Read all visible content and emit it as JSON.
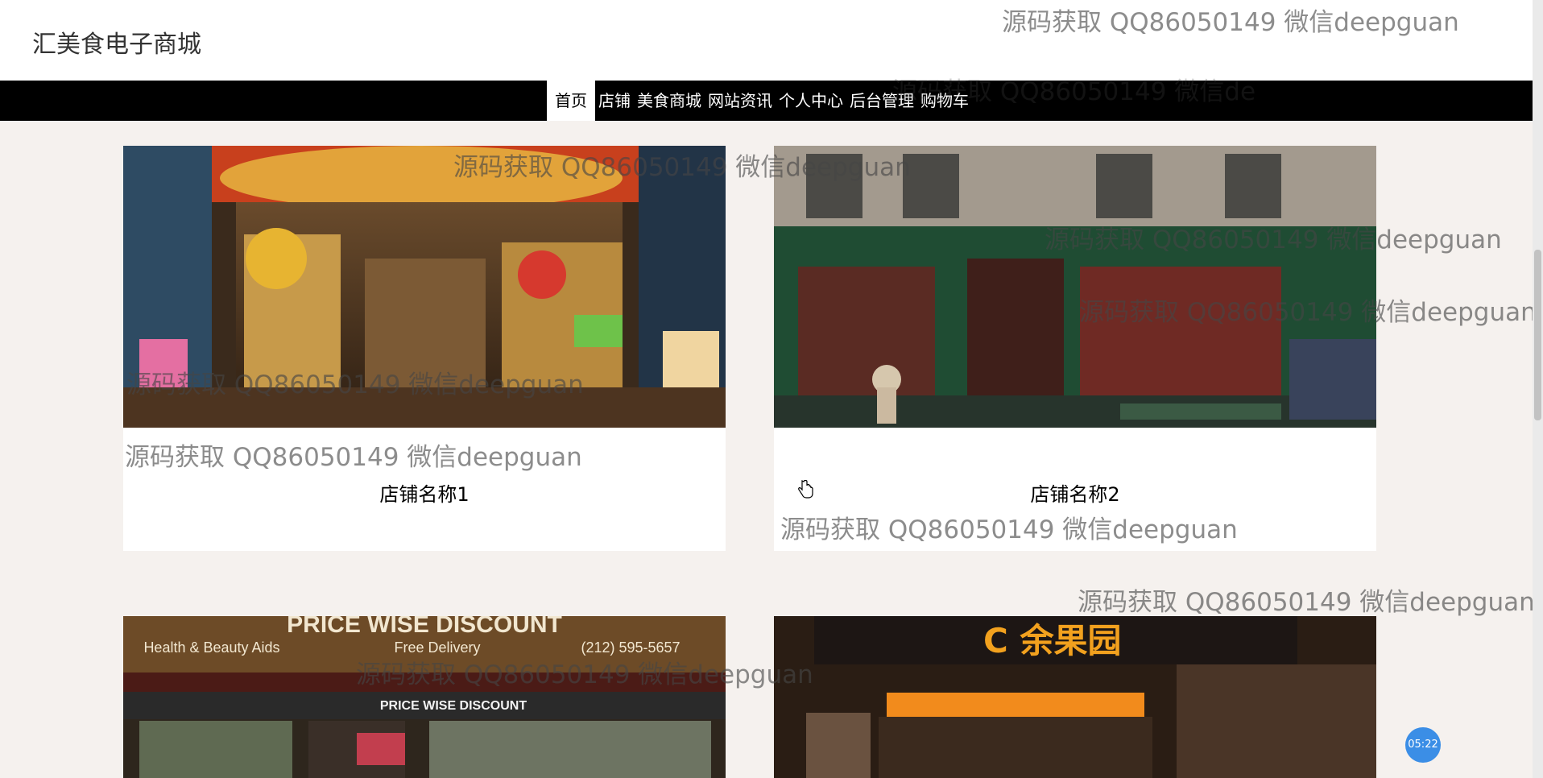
{
  "site": {
    "title": "汇美食电子商城"
  },
  "nav": {
    "items": [
      {
        "label": "首页",
        "active": true
      },
      {
        "label": "店铺"
      },
      {
        "label": "美食商城"
      },
      {
        "label": "网站资讯"
      },
      {
        "label": "个人中心"
      },
      {
        "label": "后台管理"
      },
      {
        "label": "购物车"
      }
    ]
  },
  "shops": [
    {
      "name": "店铺名称1"
    },
    {
      "name": "店铺名称2"
    },
    {
      "name": ""
    },
    {
      "name": ""
    }
  ],
  "watermark": {
    "text": "源码获取 QQ86050149 微信deepguan",
    "partial_text": "源码获取 QQ86050149 微信de"
  },
  "timer": {
    "text": "05:22"
  },
  "colors": {
    "navbar": "#000000",
    "page_bg": "#f5f1ee",
    "timer": "#3b8ee6"
  }
}
